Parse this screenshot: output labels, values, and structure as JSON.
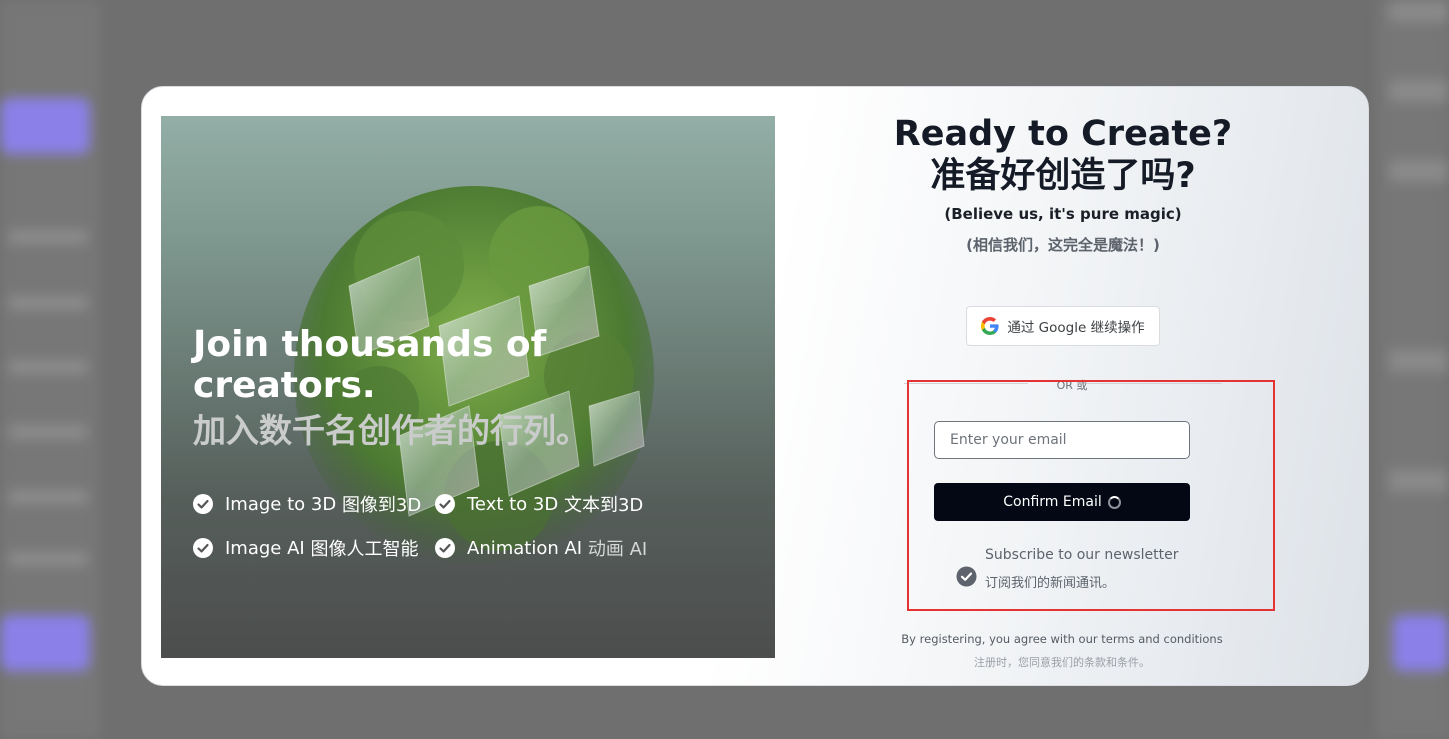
{
  "hero": {
    "title": "Join thousands of creators.",
    "subtitle": "加入数千名创作者的行列。",
    "features": [
      {
        "en": "Image to 3D",
        "cn": "图像到3D",
        "icon": "check-circle-icon"
      },
      {
        "en": "Text to 3D",
        "cn": "文本到3D",
        "icon": "check-circle-icon"
      },
      {
        "en": "Image AI",
        "cn": "图像人工智能",
        "icon": "check-circle-icon"
      },
      {
        "en": "Animation AI",
        "cn": "动画 AI",
        "icon": "check-circle-icon"
      }
    ]
  },
  "form": {
    "title": "Ready to Create? 准备好创造了吗?",
    "tagline": "(Believe us, it's pure magic)",
    "tagline_cn": "(相信我们，这完全是魔法！)",
    "google_button": "通过 Google 继续操作",
    "divider": "OR 或",
    "email_placeholder": "Enter your email",
    "email_value": "",
    "confirm_button": "Confirm Email",
    "newsletter_en": "Subscribe to our newsletter",
    "newsletter_cn": "订阅我们的新闻通讯。",
    "newsletter_checked": true,
    "terms_en": "By registering, you agree with our terms and conditions",
    "terms_cn": "注册时，您同意我们的条款和条件。"
  },
  "colors": {
    "highlight_border": "#e53232",
    "confirm_button_bg": "#030814",
    "title_text": "#141a26"
  }
}
